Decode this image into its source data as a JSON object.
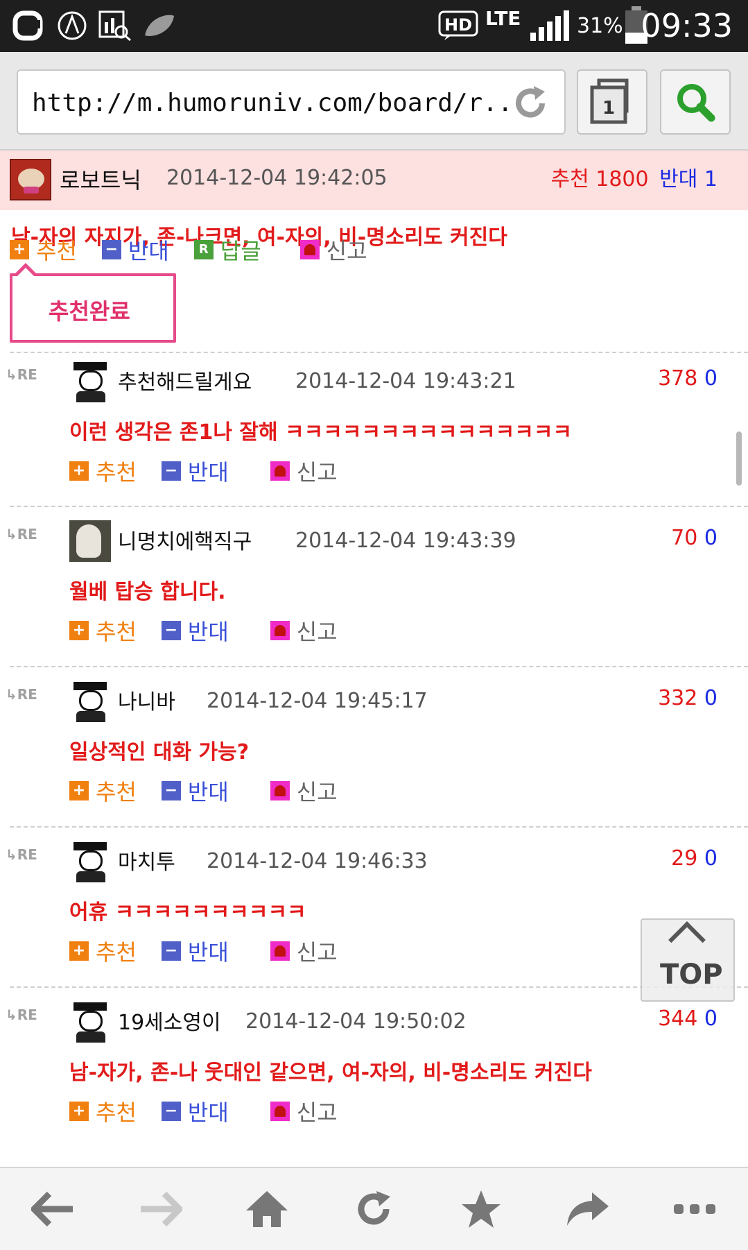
{
  "status_bar": {
    "battery": "31%",
    "network": "LTE",
    "hd": "HD",
    "time": "09:33"
  },
  "browser": {
    "url": "http://m.humoruniv.com/board/r...",
    "tab_count": "1"
  },
  "post": {
    "author": "로보트닉",
    "date": "2014-12-04 19:42:05",
    "recommend_label": "추천",
    "recommend_count": "1800",
    "oppose_label": "반대",
    "oppose_count": "1",
    "title": "남-자의 자지가, 존-나크면, 여-자의, 비-명소리도 커진다",
    "actions": {
      "recommend": "추천",
      "oppose": "반대",
      "reply": "답글",
      "report": "신고"
    },
    "toast": "추천완료"
  },
  "replies": [
    {
      "tag": "RE",
      "author": "추천해드릴게요",
      "date": "2014-12-04 19:43:21",
      "up": "378",
      "down": "0",
      "text": "이런 생각은 존1나 잘해 ㅋㅋㅋㅋㅋㅋㅋㅋㅋㅋㅋㅋㅋㅋㅋ",
      "avatar": "default"
    },
    {
      "tag": "RE",
      "author": "니명치에핵직구",
      "date": "2014-12-04 19:43:39",
      "up": "70",
      "down": "0",
      "text": "월베 탑승 합니다.",
      "avatar": "photo"
    },
    {
      "tag": "RE",
      "author": "나니바",
      "date": "2014-12-04 19:45:17",
      "up": "332",
      "down": "0",
      "text": "일상적인 대화 가능?",
      "avatar": "default"
    },
    {
      "tag": "RE",
      "author": "마치투",
      "date": "2014-12-04 19:46:33",
      "up": "29",
      "down": "0",
      "text": "어휴 ㅋㅋㅋㅋㅋㅋㅋㅋㅋㅋ",
      "avatar": "default"
    },
    {
      "tag": "RE",
      "author": "19세소영이",
      "date": "2014-12-04 19:50:02",
      "up": "344",
      "down": "0",
      "text": "남-자가, 존-나 웃대인 같으면, 여-자의, 비-명소리도 커진다",
      "avatar": "default"
    }
  ],
  "reply_actions": {
    "recommend": "추천",
    "oppose": "반대",
    "report": "신고"
  },
  "top_button": "TOP",
  "colors": {
    "recommend": "#e21a1a",
    "oppose": "#1a2ae2",
    "highlight_bg": "#fde0e0",
    "toast_border": "#e64b8a"
  }
}
